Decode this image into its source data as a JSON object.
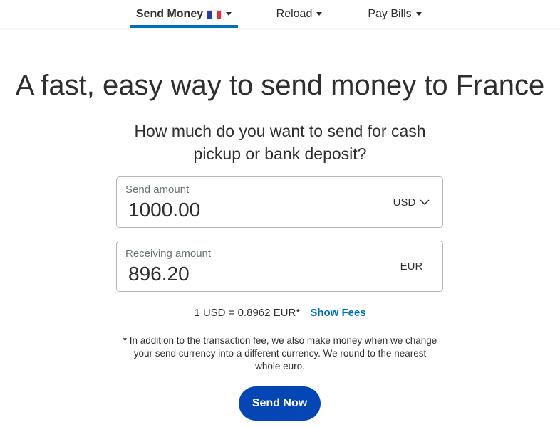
{
  "nav": {
    "send_money": "Send Money",
    "send_money_flag": "france-flag-icon",
    "reload": "Reload",
    "pay_bills": "Pay Bills"
  },
  "heading": {
    "title": "A fast, easy way to send money to France",
    "subtitle": "How much do you want to send for cash pickup or bank deposit?"
  },
  "send": {
    "label": "Send amount",
    "value": "1000.00",
    "currency": "USD"
  },
  "receive": {
    "label": "Receiving amount",
    "value": "896.20",
    "currency": "EUR"
  },
  "rate": {
    "text": "1 USD = 0.8962 EUR*",
    "show_fees": "Show Fees"
  },
  "disclaimer": "* In addition to the transaction fee, we also make money when we change your send currency into a different currency. We round to the nearest whole euro.",
  "actions": {
    "send_now": "Send Now"
  },
  "colors": {
    "accent": "#0070ba",
    "button": "#0546b5",
    "text": "#2c2e2f"
  }
}
